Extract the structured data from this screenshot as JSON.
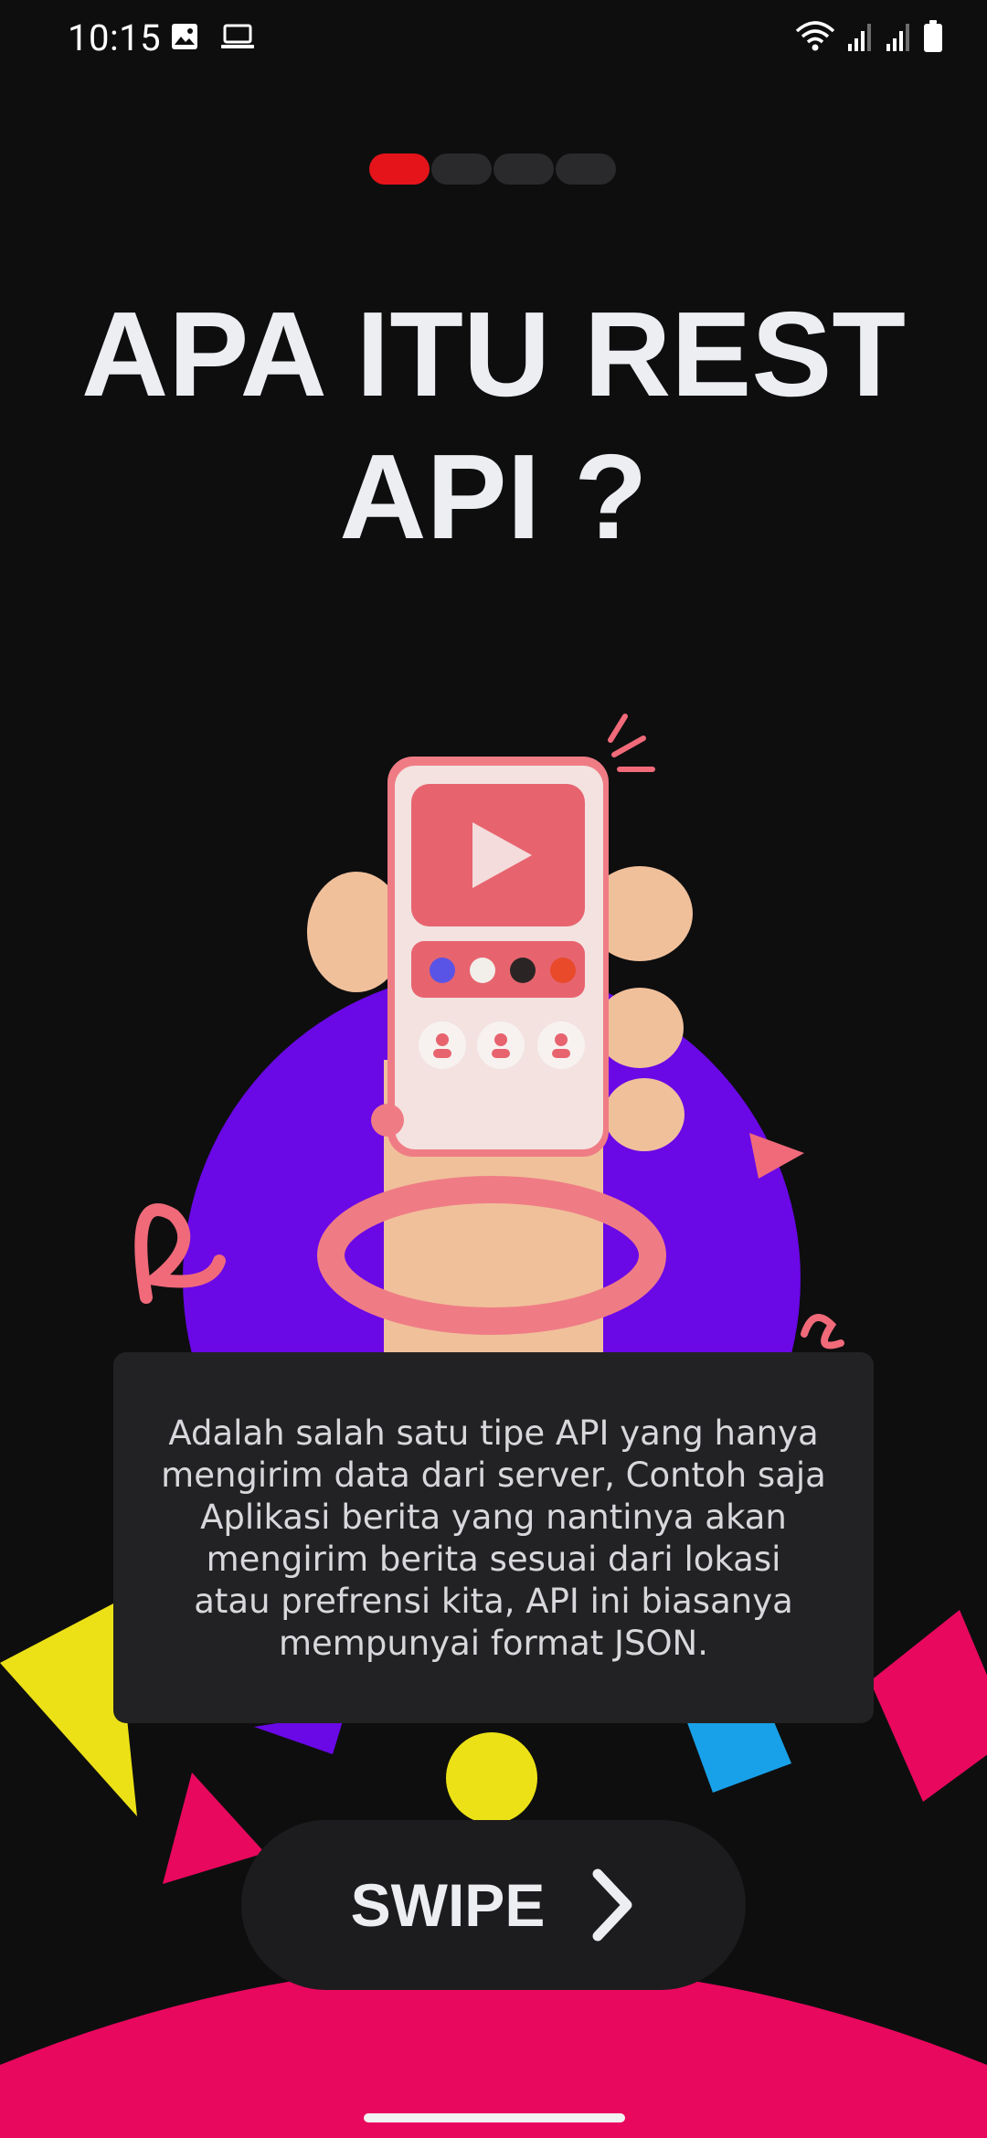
{
  "status_bar": {
    "time": "10:15",
    "left_icons": [
      "image-icon",
      "laptop-icon"
    ],
    "right_icons": [
      "wifi-icon",
      "signal-icon",
      "signal-icon",
      "battery-icon"
    ]
  },
  "onboarding": {
    "page_count": 4,
    "active_page": 1,
    "title_line1": "APA ITU REST",
    "title_line2": "API ?",
    "description_lines": [
      "Adalah salah satu tipe API yang hanya",
      "mengirim data dari server, Contoh saja",
      "Aplikasi berita yang nantinya akan",
      "mengirim berita sesuai dari lokasi",
      "atau prefrensi kita, API ini biasanya",
      "mempunyai format JSON."
    ],
    "swipe_label": "SWIPE"
  },
  "colors": {
    "background": "#0e0e0f",
    "accent_red": "#e4141a",
    "purple": "#6a08e6",
    "pink": "#e8085e",
    "yellow": "#ece116",
    "blue": "#18a1e8"
  }
}
